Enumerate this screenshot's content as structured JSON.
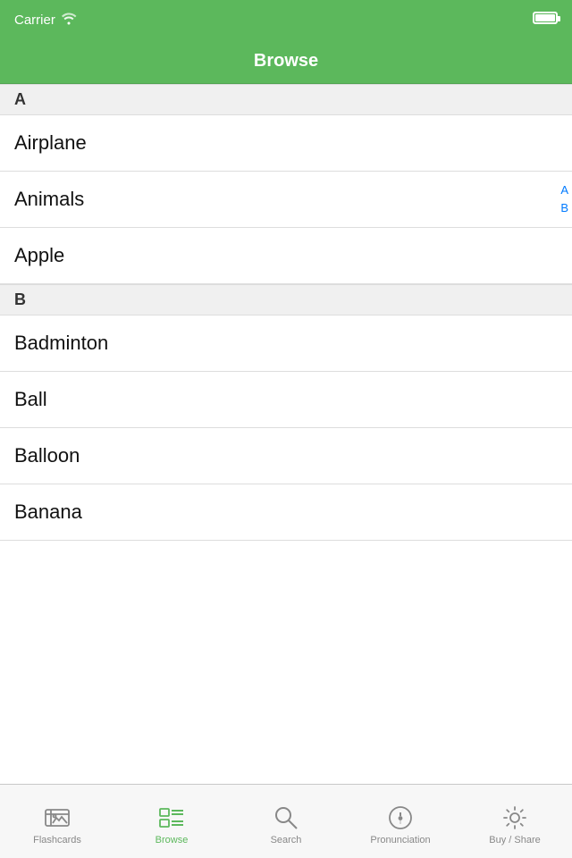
{
  "statusBar": {
    "carrier": "Carrier",
    "wifiSymbol": "📶"
  },
  "navBar": {
    "title": "Browse"
  },
  "indexLetters": [
    "A",
    "B"
  ],
  "sections": [
    {
      "letter": "A",
      "items": [
        "Airplane",
        "Animals",
        "Apple"
      ]
    },
    {
      "letter": "B",
      "items": [
        "Badminton",
        "Ball",
        "Balloon",
        "Banana"
      ]
    }
  ],
  "tabBar": {
    "tabs": [
      {
        "id": "flashcards",
        "label": "Flashcards",
        "active": false
      },
      {
        "id": "browse",
        "label": "Browse",
        "active": true
      },
      {
        "id": "search",
        "label": "Search",
        "active": false
      },
      {
        "id": "pronunciation",
        "label": "Pronunciation",
        "active": false
      },
      {
        "id": "buy-share",
        "label": "Buy / Share",
        "active": false
      }
    ]
  }
}
